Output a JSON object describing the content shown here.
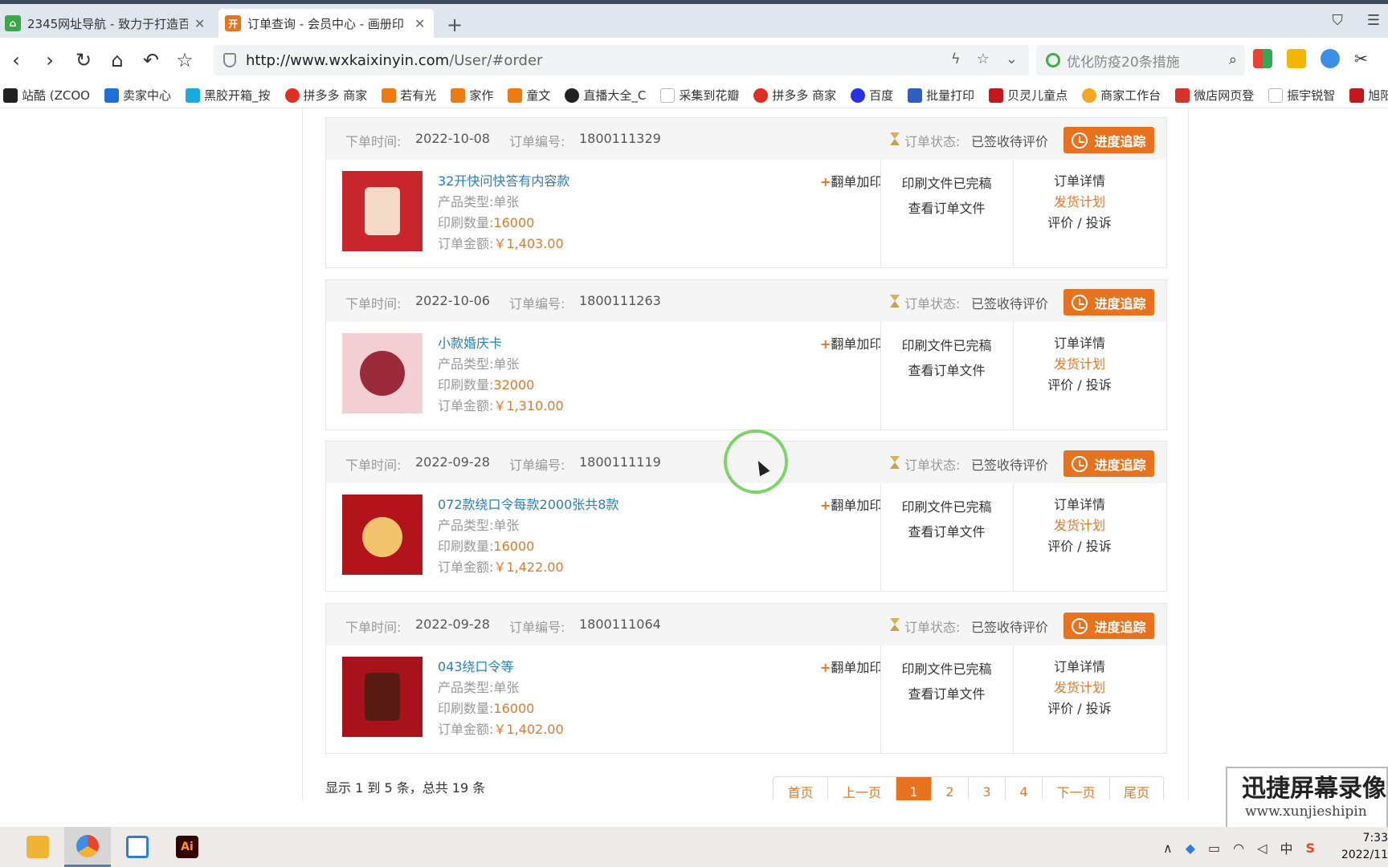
{
  "browser": {
    "tabs": [
      {
        "title": "2345网址导航 - 致力于打造百",
        "icon": "house-icon"
      },
      {
        "title": "订单查询 - 会员中心 - 画册印",
        "icon": "site-favicon",
        "favicon_text": "开"
      }
    ],
    "new_tab_symbol": "+",
    "url_host": "http://www.wxkaixinyin.com",
    "url_path": "/User/#order",
    "search_placeholder": "优化防疫20条措施",
    "bookmarks": [
      {
        "label": "站酷 (ZCOO",
        "color": "#222222"
      },
      {
        "label": "卖家中心",
        "color": "#1e6fd9"
      },
      {
        "label": "黑胶开箱_按",
        "color": "#19a9e1"
      },
      {
        "label": "拼多多 商家",
        "color": "#e02e24"
      },
      {
        "label": "若有光",
        "color": "#f07a12"
      },
      {
        "label": "家作",
        "color": "#f07a12"
      },
      {
        "label": "童文",
        "color": "#f07a12"
      },
      {
        "label": "直播大全_C",
        "color": "#222222"
      },
      {
        "label": "采集到花瓣",
        "color": "#bbbbbb"
      },
      {
        "label": "拼多多 商家",
        "color": "#e02e24"
      },
      {
        "label": "百度",
        "color": "#2932e1"
      },
      {
        "label": "批量打印",
        "color": "#2f5fc4"
      },
      {
        "label": "贝灵儿童点",
        "color": "#c4161c"
      },
      {
        "label": "商家工作台",
        "color": "#f5a623"
      },
      {
        "label": "微店网页登",
        "color": "#d9302c"
      },
      {
        "label": "振宇锐智",
        "color": "#bbbbbb"
      },
      {
        "label": "旭阳印",
        "color": "#c4161c"
      }
    ]
  },
  "labels": {
    "order_time": "下单时间:",
    "order_no": "订单编号:",
    "order_status": "订单状态:",
    "track_button": "进度追踪",
    "product_type": "产品类型:",
    "print_qty": "印刷数量:",
    "order_amount": "订单金额:",
    "reprint": "翻单加印",
    "reprint_plus": "+",
    "file_done": "印刷文件已完稿",
    "view_files": "查看订单文件",
    "order_detail": "订单详情",
    "ship_plan": "发货计划",
    "review_complain": "评价 / 投诉"
  },
  "orders": [
    {
      "date": "2022-10-08",
      "number": "1800111329",
      "status": "已签收待评价",
      "product": "32开快问快答有内容款",
      "type": "单张",
      "qty": "16000",
      "amount": "￥1,403.00",
      "thumb_color": "#c8252c",
      "thumb_accent": "#f4d9c7"
    },
    {
      "date": "2022-10-06",
      "number": "1800111263",
      "status": "已签收待评价",
      "product": "小款婚庆卡",
      "type": "单张",
      "qty": "32000",
      "amount": "￥1,310.00",
      "thumb_color": "#f3cfd3",
      "thumb_accent": "#9b2a3a"
    },
    {
      "date": "2022-09-28",
      "number": "1800111119",
      "status": "已签收待评价",
      "product": "072款绕口令每款2000张共8款",
      "type": "单张",
      "qty": "16000",
      "amount": "￥1,422.00",
      "thumb_color": "#b3141c",
      "thumb_accent": "#f2c46d"
    },
    {
      "date": "2022-09-28",
      "number": "1800111064",
      "status": "已签收待评价",
      "product": "043绕口令等",
      "type": "单张",
      "qty": "16000",
      "amount": "￥1,402.00",
      "thumb_color": "#a8121a",
      "thumb_accent": "#5a1a14"
    }
  ],
  "summary": "显示 1 到 5 条，总共 19 条",
  "pagination": [
    "首页",
    "上一页",
    "1",
    "2",
    "3",
    "4",
    "下一页",
    "尾页"
  ],
  "current_page": "1",
  "watermark": {
    "title": "迅捷屏幕录像",
    "sub": "www.xunjieshipin"
  },
  "taskbar": {
    "apps": [
      {
        "name": "file-explorer-icon",
        "color": "#f2b233"
      },
      {
        "name": "browser-icon",
        "color": "#e8452c"
      },
      {
        "name": "baidu-netdisk-icon",
        "color": "#2d7be5"
      },
      {
        "name": "illustrator-icon",
        "color": "#330000",
        "text": "Ai"
      }
    ],
    "ime": "中",
    "time": "7:33",
    "date": "2022/11"
  },
  "colors": {
    "accent": "#e8721e",
    "link": "#2a7fb8"
  }
}
